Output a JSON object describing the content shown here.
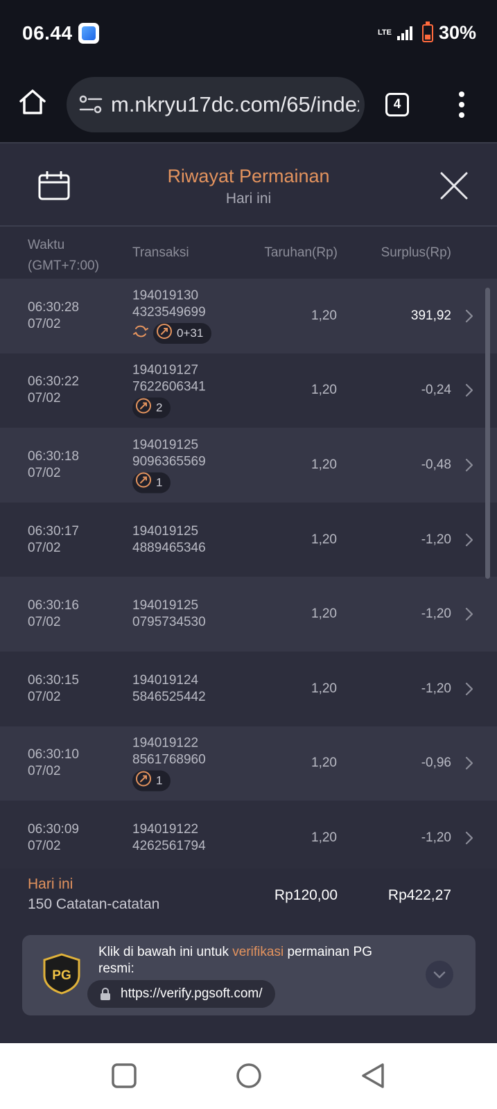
{
  "status_bar": {
    "time": "06.44",
    "network": "LTE",
    "battery": "30%"
  },
  "browser": {
    "url": "m.nkryu17dc.com/65/index",
    "tab_count": "4"
  },
  "header": {
    "title": "Riwayat Permainan",
    "subtitle": "Hari ini"
  },
  "columns": {
    "time": "Waktu",
    "timezone": "(GMT+7:00)",
    "transaction": "Transaksi",
    "bet": "Taruhan(Rp)",
    "surplus": "Surplus(Rp)"
  },
  "rows": [
    {
      "time": "06:30:28",
      "date": "07/02",
      "tx1": "194019130",
      "tx2": "4323549699",
      "bet": "1,20",
      "surplus": "391,92",
      "win": true,
      "badge": "0+31",
      "respin": true
    },
    {
      "time": "06:30:22",
      "date": "07/02",
      "tx1": "194019127",
      "tx2": "7622606341",
      "bet": "1,20",
      "surplus": "-0,24",
      "win": false,
      "badge": "2",
      "respin": false
    },
    {
      "time": "06:30:18",
      "date": "07/02",
      "tx1": "194019125",
      "tx2": "9096365569",
      "bet": "1,20",
      "surplus": "-0,48",
      "win": false,
      "badge": "1",
      "respin": false
    },
    {
      "time": "06:30:17",
      "date": "07/02",
      "tx1": "194019125",
      "tx2": "4889465346",
      "bet": "1,20",
      "surplus": "-1,20",
      "win": false,
      "badge": "",
      "respin": false
    },
    {
      "time": "06:30:16",
      "date": "07/02",
      "tx1": "194019125",
      "tx2": "0795734530",
      "bet": "1,20",
      "surplus": "-1,20",
      "win": false,
      "badge": "",
      "respin": false
    },
    {
      "time": "06:30:15",
      "date": "07/02",
      "tx1": "194019124",
      "tx2": "5846525442",
      "bet": "1,20",
      "surplus": "-1,20",
      "win": false,
      "badge": "",
      "respin": false
    },
    {
      "time": "06:30:10",
      "date": "07/02",
      "tx1": "194019122",
      "tx2": "8561768960",
      "bet": "1,20",
      "surplus": "-0,96",
      "win": false,
      "badge": "1",
      "respin": false
    },
    {
      "time": "06:30:09",
      "date": "07/02",
      "tx1": "194019122",
      "tx2": "4262561794",
      "bet": "1,20",
      "surplus": "-1,20",
      "win": false,
      "badge": "",
      "respin": false
    }
  ],
  "summary": {
    "label": "Hari ini",
    "count": "150 Catatan-catatan",
    "total_bet": "Rp120,00",
    "total_surplus": "Rp422,27"
  },
  "verify": {
    "text_before": "Klik di bawah ini untuk ",
    "text_highlight": "verifikasi",
    "text_after": " permainan PG resmi:",
    "link": "https://verify.pgsoft.com/",
    "logo_text": "PG"
  },
  "colors": {
    "accent": "#e3935e",
    "background": "#2b2c3b",
    "row_alt": "#363747"
  }
}
